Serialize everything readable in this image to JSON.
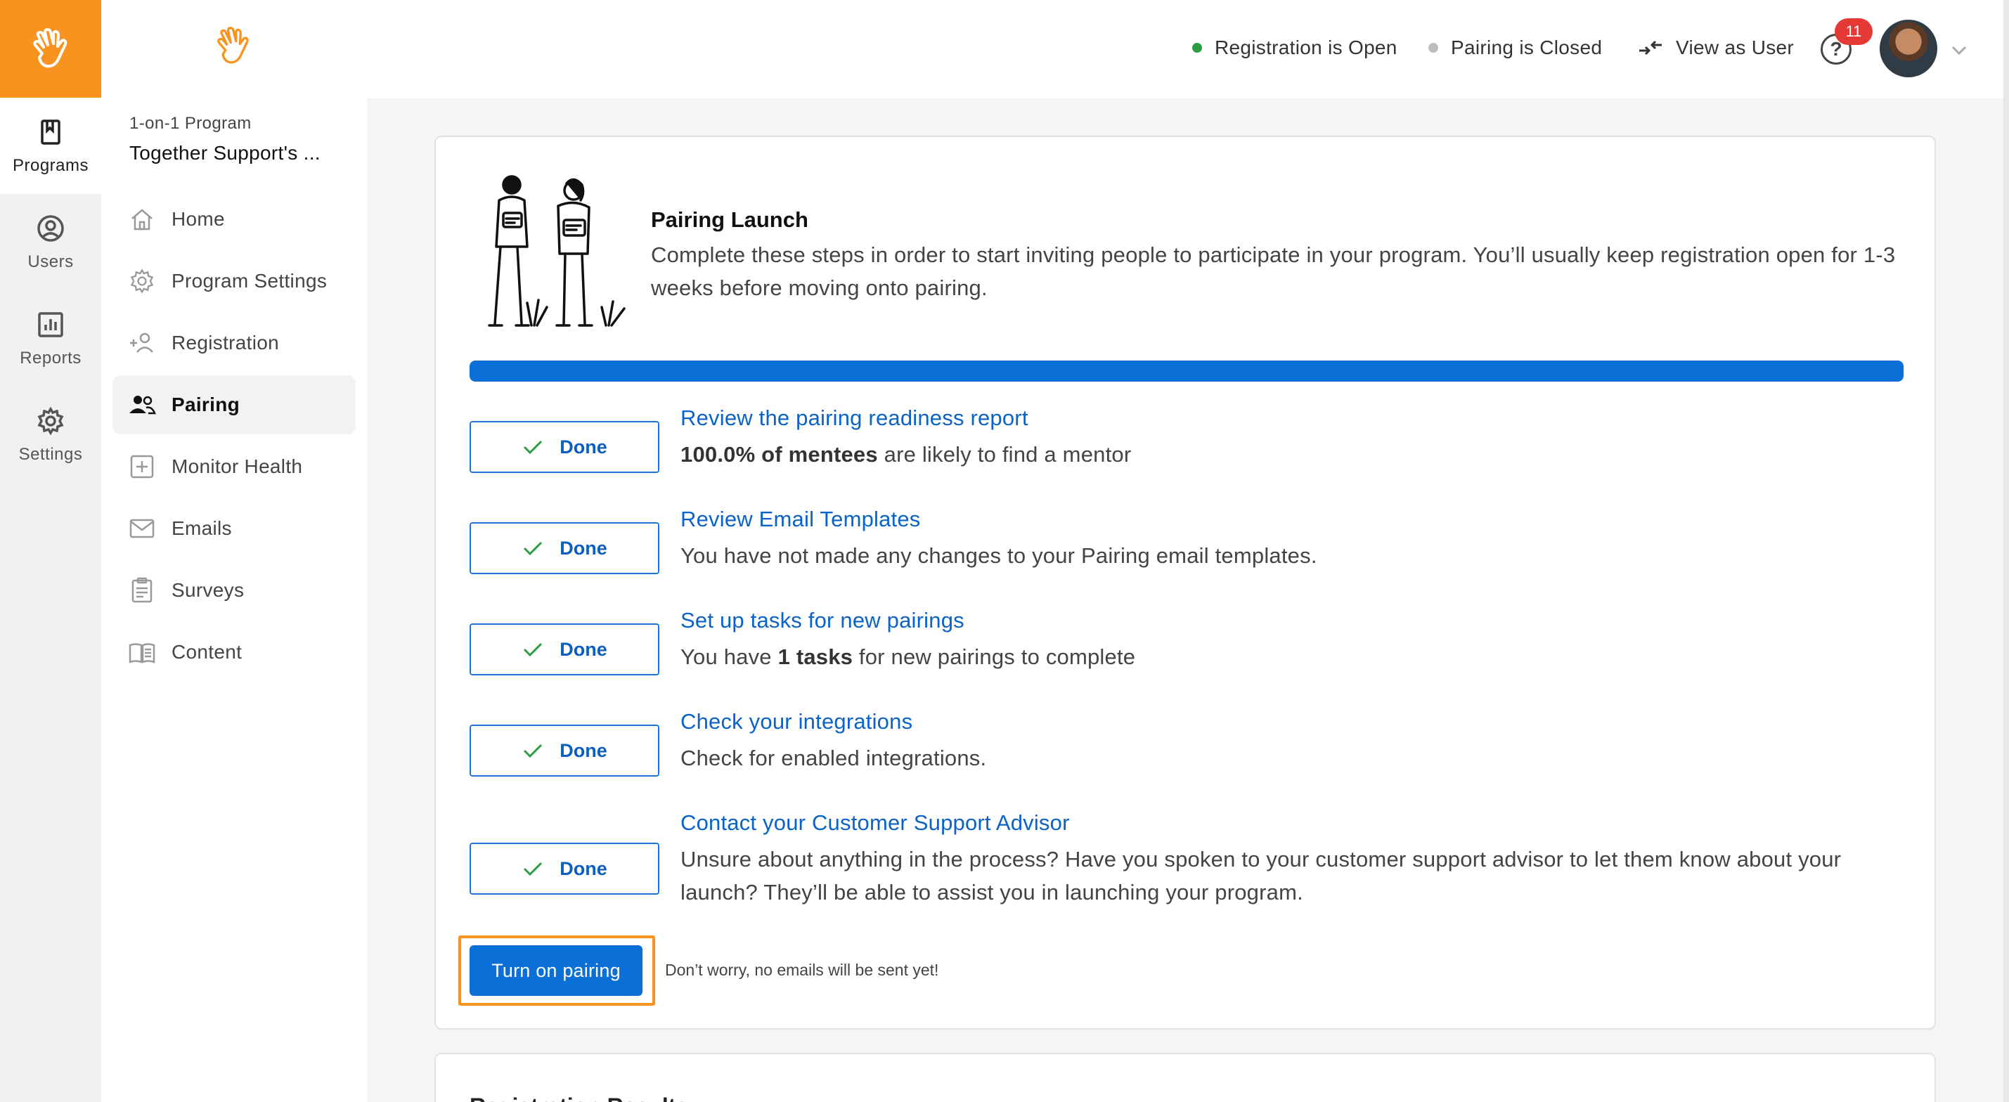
{
  "rail": {
    "items": [
      {
        "label": "Programs",
        "icon": "bookmark-icon",
        "active": true
      },
      {
        "label": "Users",
        "icon": "user-circle-icon",
        "active": false
      },
      {
        "label": "Reports",
        "icon": "chart-icon",
        "active": false
      },
      {
        "label": "Settings",
        "icon": "gear-icon",
        "active": false
      }
    ]
  },
  "sidebar": {
    "program_type": "1-on-1 Program",
    "program_name": "Together Support's ...",
    "items": [
      {
        "label": "Home",
        "icon": "home-icon"
      },
      {
        "label": "Program Settings",
        "icon": "gear-icon"
      },
      {
        "label": "Registration",
        "icon": "add-user-icon"
      },
      {
        "label": "Pairing",
        "icon": "users-icon",
        "active": true
      },
      {
        "label": "Monitor Health",
        "icon": "plus-box-icon"
      },
      {
        "label": "Emails",
        "icon": "envelope-icon"
      },
      {
        "label": "Surveys",
        "icon": "clipboard-icon"
      },
      {
        "label": "Content",
        "icon": "book-icon"
      }
    ]
  },
  "topbar": {
    "registration_status": "Registration is Open",
    "pairing_status": "Pairing is Closed",
    "view_as_user": "View as User",
    "help_glyph": "?",
    "notification_count": "11",
    "colors": {
      "open": "#2e9e44",
      "closed": "#bdbdbd"
    }
  },
  "launch": {
    "title": "Pairing Launch",
    "description": "Complete these steps in order to start inviting people to participate in your program. You’ll usually keep registration open for 1-3 weeks before moving onto pairing.",
    "progress_percent": 100,
    "steps": [
      {
        "button": "Done",
        "title": "Review the pairing readiness report",
        "desc_bold": "100.0% of mentees",
        "desc_rest": " are likely to find a mentor"
      },
      {
        "button": "Done",
        "title": "Review Email Templates",
        "desc": "You have not made any changes to your Pairing email templates."
      },
      {
        "button": "Done",
        "title": "Set up tasks for new pairings",
        "desc_pre": "You have ",
        "desc_bold": "1 tasks",
        "desc_rest": " for new pairings to complete"
      },
      {
        "button": "Done",
        "title": "Check your integrations",
        "desc": "Check for enabled integrations."
      },
      {
        "button": "Done",
        "title": "Contact your Customer Support Advisor",
        "desc": "Unsure about anything in the process? Have you spoken to your customer support advisor to let them know about your launch? They’ll be able to assist you in launching your program."
      }
    ],
    "cta_label": "Turn on pairing",
    "cta_note": "Don’t worry, no emails will be sent yet!"
  },
  "next_card": {
    "title": "Registration Results"
  },
  "colors": {
    "brand": "#f7931e",
    "primary": "#0a6fd6",
    "link": "#0a63c9"
  }
}
